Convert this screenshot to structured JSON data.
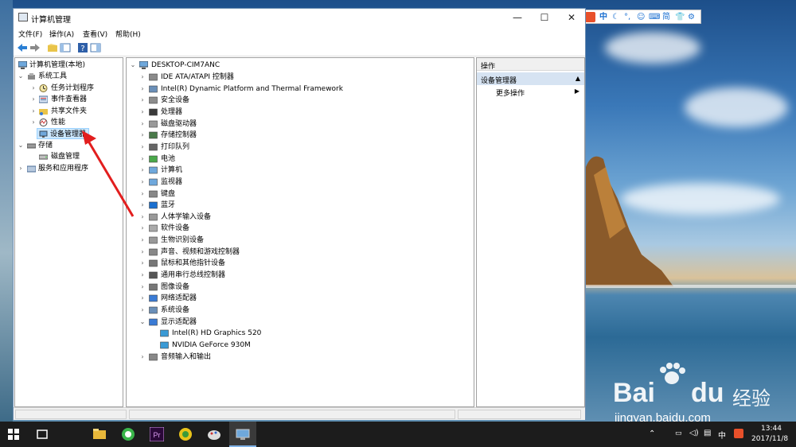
{
  "window": {
    "title": "计算机管理",
    "controls": {
      "minimize": "—",
      "maximize": "☐",
      "close": "✕"
    }
  },
  "menu": [
    "文件(F)",
    "操作(A)",
    "查看(V)",
    "帮助(H)"
  ],
  "left_tree": [
    {
      "label": "计算机管理(本地)",
      "level": 0,
      "expander": ""
    },
    {
      "label": "系统工具",
      "level": 1,
      "expander": "⌄"
    },
    {
      "label": "任务计划程序",
      "level": 2,
      "expander": "›"
    },
    {
      "label": "事件查看器",
      "level": 2,
      "expander": "›"
    },
    {
      "label": "共享文件夹",
      "level": 2,
      "expander": "›"
    },
    {
      "label": "性能",
      "level": 2,
      "expander": "›"
    },
    {
      "label": "设备管理器",
      "level": 2,
      "expander": "",
      "selected": true
    },
    {
      "label": "存储",
      "level": 1,
      "expander": "⌄"
    },
    {
      "label": "磁盘管理",
      "level": 2,
      "expander": ""
    },
    {
      "label": "服务和应用程序",
      "level": 1,
      "expander": "›"
    }
  ],
  "device_tree": {
    "root": "DESKTOP-CIM7ANC",
    "items": [
      {
        "label": "IDE ATA/ATAPI 控制器",
        "expander": "›",
        "indent": 1
      },
      {
        "label": "Intel(R) Dynamic Platform and Thermal Framework",
        "expander": "›",
        "indent": 1
      },
      {
        "label": "安全设备",
        "expander": "›",
        "indent": 1
      },
      {
        "label": "处理器",
        "expander": "›",
        "indent": 1
      },
      {
        "label": "磁盘驱动器",
        "expander": "›",
        "indent": 1
      },
      {
        "label": "存储控制器",
        "expander": "›",
        "indent": 1
      },
      {
        "label": "打印队列",
        "expander": "›",
        "indent": 1
      },
      {
        "label": "电池",
        "expander": "›",
        "indent": 1
      },
      {
        "label": "计算机",
        "expander": "›",
        "indent": 1
      },
      {
        "label": "监视器",
        "expander": "›",
        "indent": 1
      },
      {
        "label": "键盘",
        "expander": "›",
        "indent": 1
      },
      {
        "label": "蓝牙",
        "expander": "›",
        "indent": 1
      },
      {
        "label": "人体学输入设备",
        "expander": "›",
        "indent": 1
      },
      {
        "label": "软件设备",
        "expander": "›",
        "indent": 1
      },
      {
        "label": "生物识别设备",
        "expander": "›",
        "indent": 1
      },
      {
        "label": "声音、视频和游戏控制器",
        "expander": "›",
        "indent": 1
      },
      {
        "label": "鼠标和其他指针设备",
        "expander": "›",
        "indent": 1
      },
      {
        "label": "通用串行总线控制器",
        "expander": "›",
        "indent": 1
      },
      {
        "label": "图像设备",
        "expander": "›",
        "indent": 1
      },
      {
        "label": "网络适配器",
        "expander": "›",
        "indent": 1
      },
      {
        "label": "系统设备",
        "expander": "›",
        "indent": 1
      },
      {
        "label": "显示适配器",
        "expander": "⌄",
        "indent": 1
      },
      {
        "label": "Intel(R) HD Graphics 520",
        "expander": "",
        "indent": 2
      },
      {
        "label": "NVIDIA GeForce 930M",
        "expander": "",
        "indent": 2
      },
      {
        "label": "音频输入和输出",
        "expander": "›",
        "indent": 1
      }
    ]
  },
  "actions": {
    "header": "操作",
    "group": "设备管理器",
    "item": "更多操作"
  },
  "ime": {
    "lang": "中",
    "simplified": "简"
  },
  "taskbar": {
    "tray_lang": "中",
    "time": "13:44",
    "date": "2017/11/8"
  },
  "watermark": {
    "brand": "Bai",
    "suffix": "du",
    "jingyan": "经验",
    "url": "jingyan.baidu.com"
  },
  "colors": {
    "accent": "#0078d7",
    "arrow": "#e21e1e",
    "selection": "#cce8ff",
    "taskbar": "#1c1c1c"
  }
}
